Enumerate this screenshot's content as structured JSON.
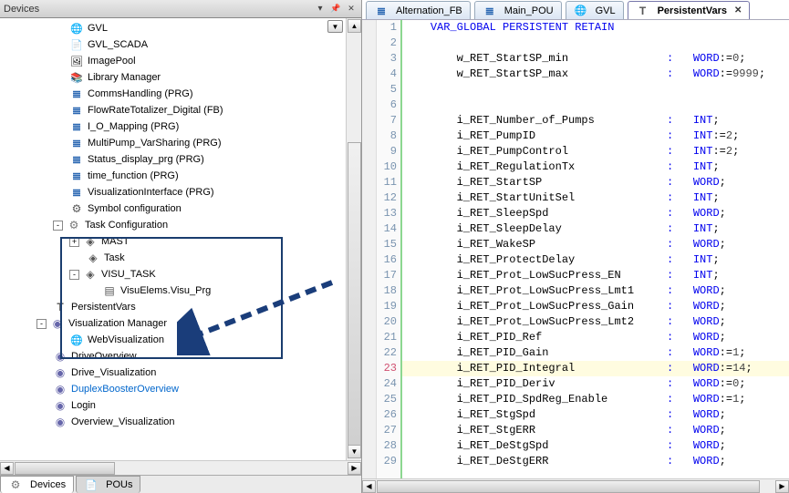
{
  "devices": {
    "header_title": "Devices",
    "footer_tabs": [
      {
        "label": "Devices",
        "icon": "i-gear",
        "active": true
      },
      {
        "label": "POUs",
        "icon": "i-doc",
        "active": false
      }
    ],
    "tree": [
      {
        "depth": 4,
        "icon": "i-globe",
        "label": "GVL"
      },
      {
        "depth": 4,
        "icon": "i-doc",
        "label": "GVL_SCADA"
      },
      {
        "depth": 4,
        "icon": "i-img",
        "label": "ImagePool"
      },
      {
        "depth": 4,
        "icon": "i-books",
        "label": "Library Manager"
      },
      {
        "depth": 4,
        "icon": "i-st",
        "label": "CommsHandling (PRG)"
      },
      {
        "depth": 4,
        "icon": "i-st",
        "label": "FlowRateTotalizer_Digital (FB)"
      },
      {
        "depth": 4,
        "icon": "i-st",
        "label": "I_O_Mapping (PRG)"
      },
      {
        "depth": 4,
        "icon": "i-st",
        "label": "MultiPump_VarSharing (PRG)"
      },
      {
        "depth": 4,
        "icon": "i-st",
        "label": "Status_display_prg (PRG)"
      },
      {
        "depth": 4,
        "icon": "i-st",
        "label": "time_function (PRG)"
      },
      {
        "depth": 4,
        "icon": "i-st",
        "label": "VisualizationInterface (PRG)"
      },
      {
        "depth": 4,
        "icon": "i-sym",
        "label": "Symbol configuration"
      },
      {
        "depth": 3,
        "toggle": "-",
        "icon": "i-gear",
        "label": "Task Configuration"
      },
      {
        "depth": 4,
        "toggle": "+",
        "icon": "i-diamonds",
        "label": "MAST"
      },
      {
        "depth": 5,
        "icon": "i-diamonds",
        "label": "Task"
      },
      {
        "depth": 4,
        "toggle": "-",
        "icon": "i-diamonds",
        "label": "VISU_TASK"
      },
      {
        "depth": 6,
        "icon": "i-stack",
        "label": "VisuElems.Visu_Prg"
      },
      {
        "depth": 3,
        "icon": "i-tt",
        "label": "PersistentVars"
      },
      {
        "depth": 2,
        "toggle": "-",
        "icon": "i-vis",
        "label": "Visualization Manager"
      },
      {
        "depth": 4,
        "icon": "i-web",
        "label": "WebVisualization"
      },
      {
        "depth": 3,
        "icon": "i-vis",
        "label": "DriveOverview"
      },
      {
        "depth": 3,
        "icon": "i-vis",
        "label": "Drive_Visualization"
      },
      {
        "depth": 3,
        "icon": "i-vis",
        "label": "DuplexBoosterOverview",
        "blue": true
      },
      {
        "depth": 3,
        "icon": "i-vis",
        "label": "Login"
      },
      {
        "depth": 3,
        "icon": "i-vis",
        "label": "Overview_Visualization"
      }
    ]
  },
  "editor": {
    "tabs": [
      {
        "label": "Alternation_FB",
        "icon": "i-st",
        "active": false
      },
      {
        "label": "Main_POU",
        "icon": "i-st",
        "active": false
      },
      {
        "label": "GVL",
        "icon": "i-globe",
        "active": false
      },
      {
        "label": "PersistentVars",
        "icon": "i-tt",
        "active": true,
        "closeable": true
      }
    ],
    "first_line_no": 1,
    "lines": [
      {
        "raw": "    ",
        "kw": "VAR_GLOBAL PERSISTENT RETAIN"
      },
      {
        "raw": ""
      },
      {
        "name": "w_RET_StartSP_min",
        "type": "WORD",
        "val": "0"
      },
      {
        "name": "w_RET_StartSP_max",
        "type": "WORD",
        "val": "9999"
      },
      {
        "raw": ""
      },
      {
        "raw": ""
      },
      {
        "name": "i_RET_Number_of_Pumps",
        "type": "INT"
      },
      {
        "name": "i_RET_PumpID",
        "type": "INT",
        "val": "2"
      },
      {
        "name": "i_RET_PumpControl",
        "type": "INT",
        "val": "2"
      },
      {
        "name": "i_RET_RegulationTx",
        "type": "INT"
      },
      {
        "name": "i_RET_StartSP",
        "type": "WORD"
      },
      {
        "name": "i_RET_StartUnitSel",
        "type": "INT"
      },
      {
        "name": "i_RET_SleepSpd",
        "type": "WORD"
      },
      {
        "name": "i_RET_SleepDelay",
        "type": "INT"
      },
      {
        "name": "i_RET_WakeSP",
        "type": "WORD"
      },
      {
        "name": "i_RET_ProtectDelay",
        "type": "INT"
      },
      {
        "name": "i_RET_Prot_LowSucPress_EN",
        "type": "INT"
      },
      {
        "name": "i_RET_Prot_LowSucPress_Lmt1",
        "type": "WORD"
      },
      {
        "name": "i_RET_Prot_LowSucPress_Gain",
        "type": "WORD"
      },
      {
        "name": "i_RET_Prot_LowSucPress_Lmt2",
        "type": "WORD"
      },
      {
        "name": "i_RET_PID_Ref",
        "type": "WORD"
      },
      {
        "name": "i_RET_PID_Gain",
        "type": "WORD",
        "val": "1"
      },
      {
        "name": "i_RET_PID_Integral",
        "type": "WORD",
        "val": "14",
        "hl": true
      },
      {
        "name": "i_RET_PID_Deriv",
        "type": "WORD",
        "val": "0"
      },
      {
        "name": "i_RET_PID_SpdReg_Enable",
        "type": "WORD",
        "val": "1"
      },
      {
        "name": "i_RET_StgSpd",
        "type": "WORD"
      },
      {
        "name": "i_RET_StgERR",
        "type": "WORD"
      },
      {
        "name": "i_RET_DeStgSpd",
        "type": "WORD"
      },
      {
        "name": "i_RET_DeStgERR",
        "type": "WORD"
      }
    ],
    "changed_lines": [
      23
    ]
  }
}
